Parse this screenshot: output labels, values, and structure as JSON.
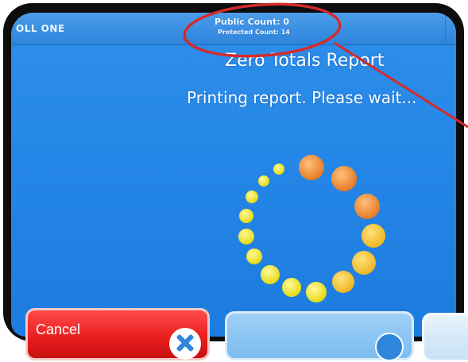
{
  "header": {
    "poll_name": "OLL ONE",
    "public_count": "Public Count: 0",
    "protected_count": "Protected Count: 14"
  },
  "main": {
    "report_title": "Zero Totals Report",
    "status_message": "Printing report. Please wait..."
  },
  "buttons": {
    "cancel_label": "Cancel"
  },
  "icons": {
    "cancel": "close-icon",
    "mid": "circle-icon",
    "spinner": "loading-spinner"
  },
  "colors": {
    "screen_blue": "#2486e6",
    "cancel_red": "#e81c1c",
    "spinner_orange": "#ee8f3c",
    "spinner_yellow": "#f3e63c",
    "annotation_red": "#d42b2b"
  }
}
